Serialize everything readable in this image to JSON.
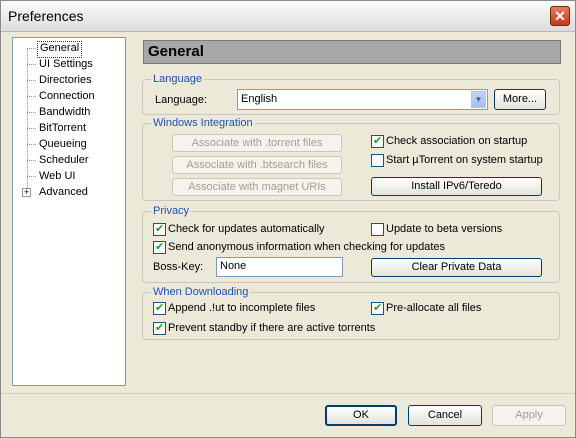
{
  "window": {
    "title": "Preferences"
  },
  "tree": {
    "items": [
      {
        "label": "General",
        "selected": true
      },
      {
        "label": "UI Settings"
      },
      {
        "label": "Directories"
      },
      {
        "label": "Connection"
      },
      {
        "label": "Bandwidth"
      },
      {
        "label": "BitTorrent"
      },
      {
        "label": "Queueing"
      },
      {
        "label": "Scheduler"
      },
      {
        "label": "Web UI"
      },
      {
        "label": "Advanced",
        "expander": "+"
      }
    ]
  },
  "header": {
    "title": "General"
  },
  "language": {
    "legend": "Language",
    "label": "Language:",
    "value": "English",
    "more_button": "More..."
  },
  "windows_integration": {
    "legend": "Windows Integration",
    "assoc_torrent": "Associate with .torrent files",
    "assoc_btsearch": "Associate with .btsearch files",
    "assoc_magnet": "Associate with magnet URIs",
    "check_assoc": {
      "label": "Check association on startup",
      "checked": true
    },
    "start_on_boot": {
      "label": "Start µTorrent on system startup",
      "checked": false
    },
    "install_ipv6": "Install IPv6/Teredo"
  },
  "privacy": {
    "legend": "Privacy",
    "check_updates": {
      "label": "Check for updates automatically",
      "checked": true
    },
    "beta_updates": {
      "label": "Update to beta versions",
      "checked": false
    },
    "send_anon": {
      "label": "Send anonymous information when checking for updates",
      "checked": true
    },
    "boss_key_label": "Boss-Key:",
    "boss_key_value": "None",
    "clear_private": "Clear Private Data"
  },
  "downloading": {
    "legend": "When Downloading",
    "append_ut": {
      "label": "Append .!ut to incomplete files",
      "checked": true
    },
    "preallocate": {
      "label": "Pre-allocate all files",
      "checked": true
    },
    "prevent_standby": {
      "label": "Prevent standby if there are active torrents",
      "checked": true
    }
  },
  "buttons": {
    "ok": "OK",
    "cancel": "Cancel",
    "apply": "Apply"
  }
}
